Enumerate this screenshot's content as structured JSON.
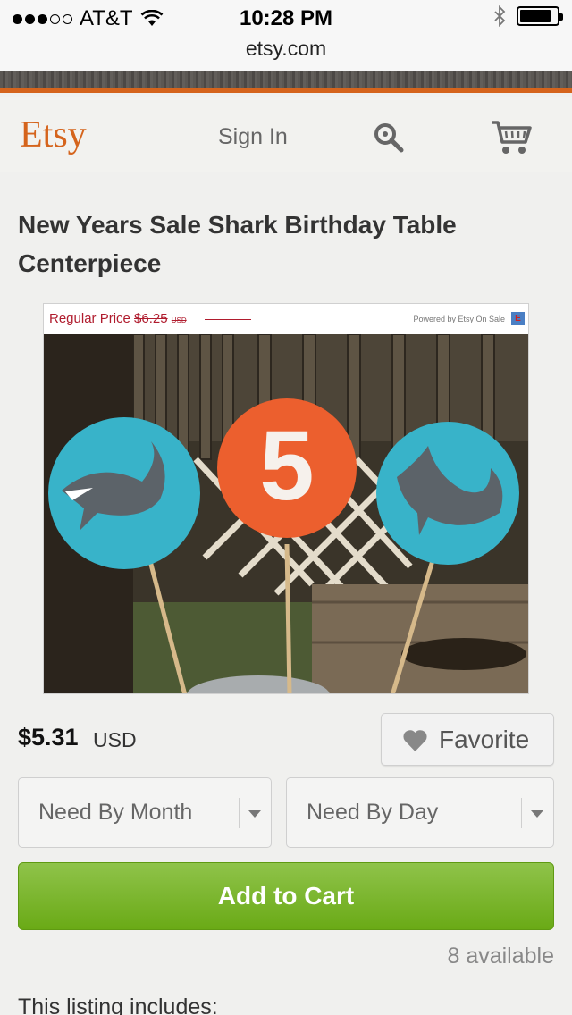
{
  "status_bar": {
    "carrier": "AT&T",
    "time": "10:28 PM"
  },
  "browser": {
    "url": "etsy.com"
  },
  "header": {
    "logo": "Etsy",
    "sign_in": "Sign In"
  },
  "listing": {
    "title": "New Years Sale Shark Birthday Table Centerpiece",
    "image_overlay": {
      "regular_price_label": "Regular Price",
      "regular_price_value": "$6.25",
      "regular_price_currency": "USD",
      "powered_by": "Powered by Etsy On Sale",
      "badge": "E",
      "number_sign": "5"
    },
    "price": "$5.31",
    "currency": "USD",
    "favorite_label": "Favorite",
    "select_month": "Need By Month",
    "select_day": "Need By Day",
    "add_to_cart": "Add to Cart",
    "availability": "8 available",
    "includes_heading": "This listing includes:"
  },
  "colors": {
    "brand_orange": "#d5641c",
    "cart_green": "#7db531",
    "sale_red": "#b01c2e"
  }
}
